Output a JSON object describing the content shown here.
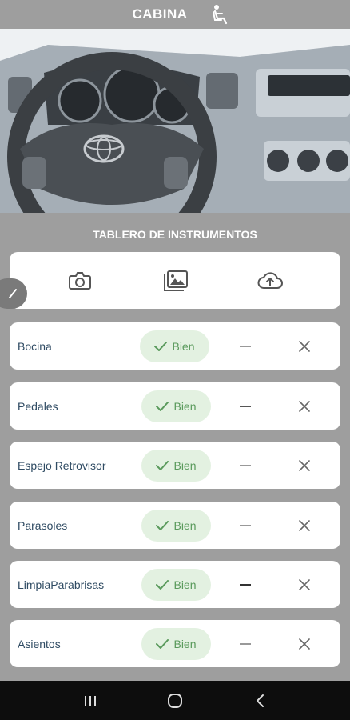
{
  "header": {
    "title": "CABINA",
    "icon": "seat-icon"
  },
  "photo": {
    "subject": "vehicle-dashboard-photo"
  },
  "section": {
    "title": "TABLERO DE INSTRUMENTOS"
  },
  "toolbar": {
    "icons": [
      "camera-icon",
      "gallery-icon",
      "upload-cloud-icon"
    ]
  },
  "items": [
    {
      "label": "Bocina",
      "ok_label": "Bien"
    },
    {
      "label": "Pedales",
      "ok_label": "Bien"
    },
    {
      "label": "Espejo Retrovisor",
      "ok_label": "Bien"
    },
    {
      "label": "Parasoles",
      "ok_label": "Bien"
    },
    {
      "label": "LimpiaParabrisas",
      "ok_label": "Bien"
    },
    {
      "label": "Asientos",
      "ok_label": "Bien"
    }
  ],
  "colors": {
    "background": "#9e9e9e",
    "ok_bg": "#e3f1e1",
    "ok_text": "#5a9a5c",
    "label": "#2f4b63"
  }
}
